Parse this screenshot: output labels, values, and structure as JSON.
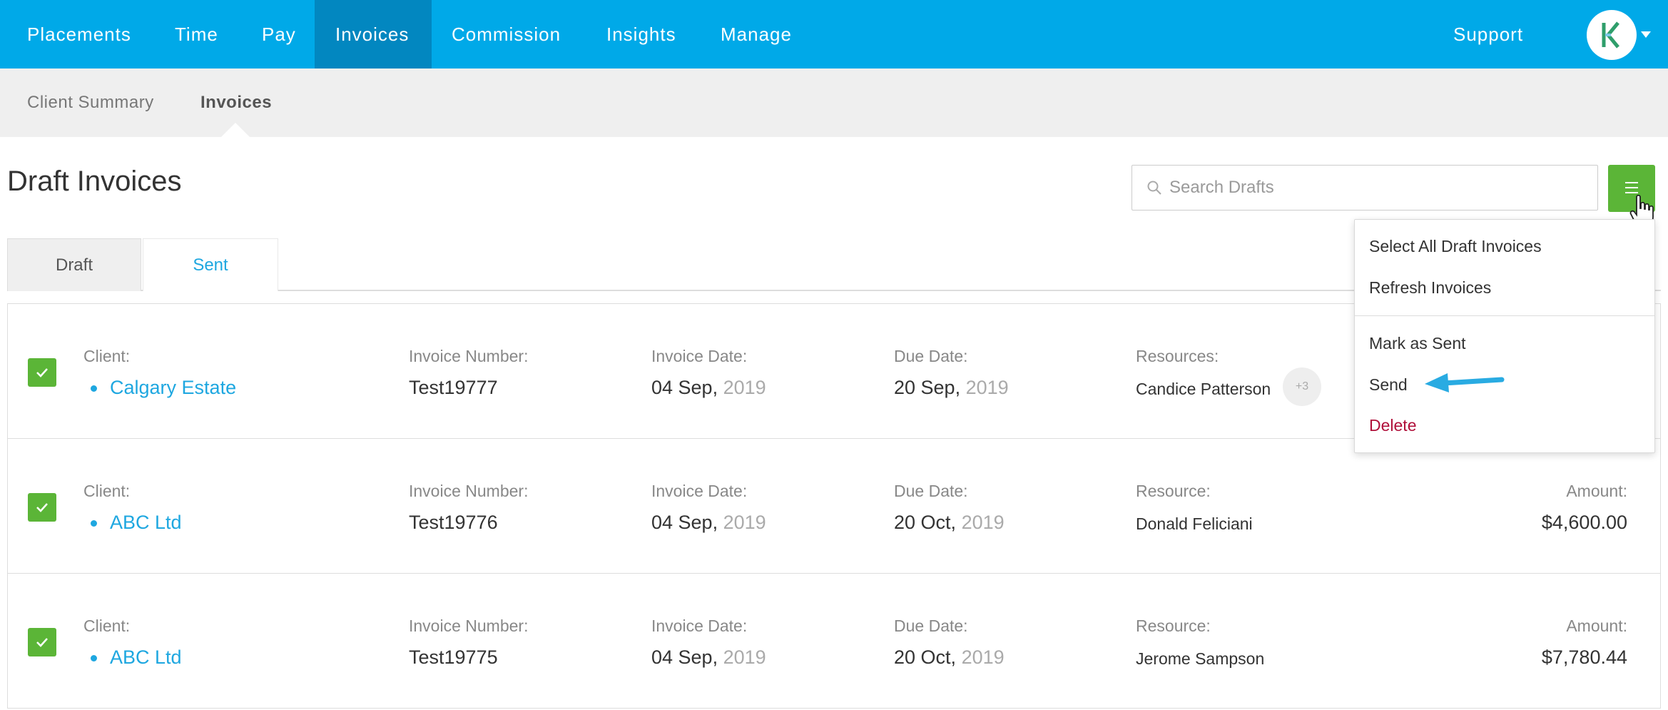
{
  "topnav": {
    "items": [
      {
        "label": "Placements"
      },
      {
        "label": "Time"
      },
      {
        "label": "Pay"
      },
      {
        "label": "Invoices"
      },
      {
        "label": "Commission"
      },
      {
        "label": "Insights"
      },
      {
        "label": "Manage"
      }
    ],
    "active_index": 3,
    "support_label": "Support",
    "brand_color": "#00a9e8",
    "active_color": "#0287c0"
  },
  "subnav": {
    "items": [
      {
        "label": "Client Summary"
      },
      {
        "label": "Invoices"
      }
    ],
    "active_index": 1
  },
  "page": {
    "title": "Draft Invoices",
    "search_placeholder": "Search Drafts",
    "menu_button_color": "#5bb537"
  },
  "tabs": [
    {
      "label": "Draft",
      "active": true
    },
    {
      "label": "Sent",
      "active": false
    }
  ],
  "invoices": [
    {
      "checked": true,
      "client_label": "Client:",
      "client": "Calgary Estate",
      "number_label": "Invoice Number:",
      "number": "Test19777",
      "invoice_date_label": "Invoice Date:",
      "invoice_date_day": "04 Sep,",
      "invoice_date_year": "2019",
      "due_date_label": "Due Date:",
      "due_date_day": "20 Sep,",
      "due_date_year": "2019",
      "resource_label": "Resources:",
      "resource": "Candice Patterson",
      "extra_resources": "+3"
    },
    {
      "checked": true,
      "client_label": "Client:",
      "client": "ABC Ltd",
      "number_label": "Invoice Number:",
      "number": "Test19776",
      "invoice_date_label": "Invoice Date:",
      "invoice_date_day": "04 Sep,",
      "invoice_date_year": "2019",
      "due_date_label": "Due Date:",
      "due_date_day": "20 Oct,",
      "due_date_year": "2019",
      "resource_label": "Resource:",
      "resource": "Donald Feliciani",
      "amount_label": "Amount:",
      "amount": "$4,600.00"
    },
    {
      "checked": true,
      "client_label": "Client:",
      "client": "ABC Ltd",
      "number_label": "Invoice Number:",
      "number": "Test19775",
      "invoice_date_label": "Invoice Date:",
      "invoice_date_day": "04 Sep,",
      "invoice_date_year": "2019",
      "due_date_label": "Due Date:",
      "due_date_day": "20 Oct,",
      "due_date_year": "2019",
      "resource_label": "Resource:",
      "resource": "Jerome Sampson",
      "amount_label": "Amount:",
      "amount": "$7,780.44"
    }
  ],
  "dropdown": {
    "group1": [
      {
        "label": "Select All Draft Invoices"
      },
      {
        "label": "Refresh Invoices"
      }
    ],
    "group2": [
      {
        "label": "Mark as Sent"
      },
      {
        "label": "Send"
      },
      {
        "label": "Delete"
      }
    ],
    "danger_color": "#b0103a",
    "highlight_arrow_color": "#29abe2"
  },
  "icons": {
    "avatar": "logo-k-icon",
    "search": "search-icon",
    "menu": "hamburger-icon",
    "cursor": "hand-cursor-icon",
    "check": "check-icon",
    "arrow": "arrow-left-icon"
  }
}
